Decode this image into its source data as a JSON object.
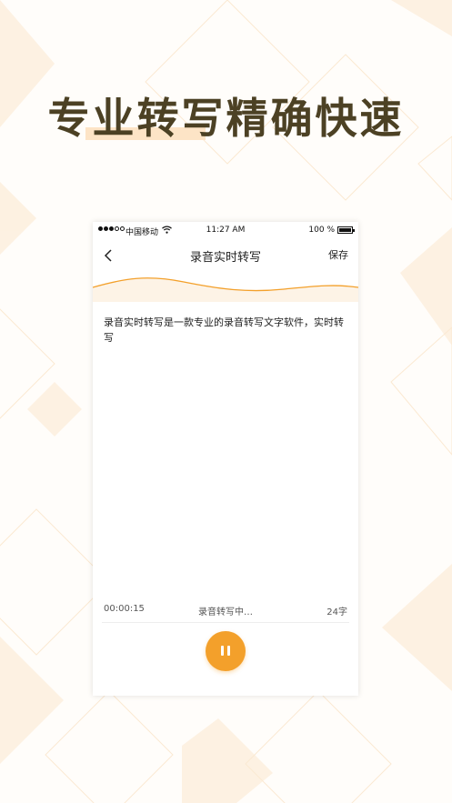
{
  "headline": "专业转写精确快速",
  "status_bar": {
    "carrier": "中国移动",
    "time": "11:27 AM",
    "battery_percent": "100 %"
  },
  "nav": {
    "title": "录音实时转写",
    "save_label": "保存"
  },
  "transcript": {
    "text": "录音实时转写是一款专业的录音转写文字软件，实时转写"
  },
  "footer": {
    "elapsed": "00:00:15",
    "status": "录音转写中…",
    "word_count": "24字"
  },
  "colors": {
    "accent": "#f3a02b",
    "headline": "#4c4124",
    "highlight": "#fde4c6"
  },
  "icons": {
    "back": "chevron-left-icon",
    "pause": "pause-icon",
    "wifi": "wifi-icon",
    "battery": "battery-icon"
  }
}
